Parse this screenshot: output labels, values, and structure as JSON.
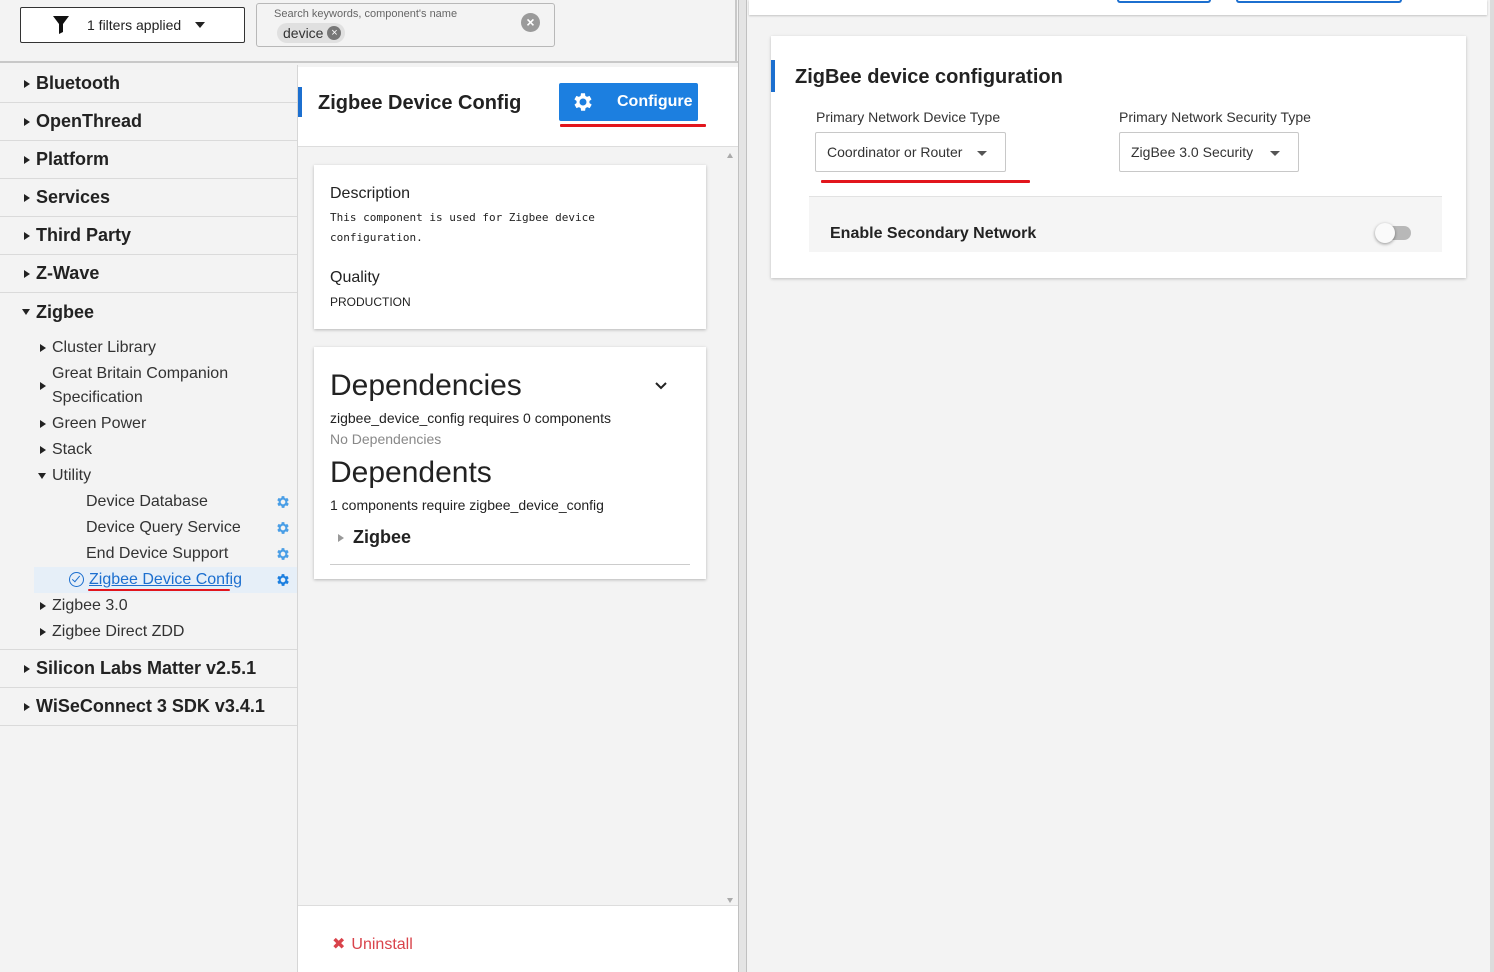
{
  "filter": {
    "label": "1 filters applied"
  },
  "search": {
    "placeholder": "Search keywords, component's name",
    "chip": "device",
    "chip_remove": "×",
    "clear": "×"
  },
  "tree": {
    "categories_top": [
      {
        "label": "Bluetooth"
      },
      {
        "label": "OpenThread"
      },
      {
        "label": "Platform"
      },
      {
        "label": "Services"
      },
      {
        "label": "Third Party"
      },
      {
        "label": "Z-Wave"
      }
    ],
    "zigbee": {
      "label": "Zigbee",
      "children": [
        {
          "label": "Cluster Library"
        },
        {
          "label": "Great Britain Companion Specification"
        },
        {
          "label": "Green Power"
        },
        {
          "label": "Stack"
        },
        {
          "label": "Utility"
        }
      ],
      "utility_items": [
        {
          "label": "Device Database"
        },
        {
          "label": "Device Query Service"
        },
        {
          "label": "End Device Support"
        },
        {
          "label": "Zigbee Device Config"
        }
      ],
      "children_after": [
        {
          "label": "Zigbee 3.0"
        },
        {
          "label": "Zigbee Direct ZDD"
        }
      ]
    },
    "categories_bottom": [
      {
        "label": "Silicon Labs Matter v2.5.1"
      },
      {
        "label": "WiSeConnect 3 SDK v3.4.1"
      }
    ]
  },
  "detail": {
    "title": "Zigbee Device Config",
    "configure_label": "Configure",
    "description_label": "Description",
    "description_text": "This component is used for Zigbee device configuration.",
    "quality_label": "Quality",
    "quality_value": "PRODUCTION",
    "dependencies_heading": "Dependencies",
    "dependencies_summary": "zigbee_device_config requires 0 components",
    "no_dependencies": "No Dependencies",
    "dependents_heading": "Dependents",
    "dependents_summary": "1 components require zigbee_device_config",
    "dependent_item": "Zigbee",
    "uninstall_label": "Uninstall",
    "uninstall_icon": "✖"
  },
  "config": {
    "title": "ZigBee device configuration",
    "device_type_label": "Primary Network Device Type",
    "device_type_value": "Coordinator or Router",
    "security_type_label": "Primary Network Security Type",
    "security_type_value": "ZigBee 3.0 Security",
    "secondary_label": "Enable Secondary Network",
    "secondary_enabled": false
  },
  "colors": {
    "accent": "#1c6fcf",
    "button": "#1c7fe0",
    "annotation": "#e2161d",
    "danger": "#d9434b"
  }
}
